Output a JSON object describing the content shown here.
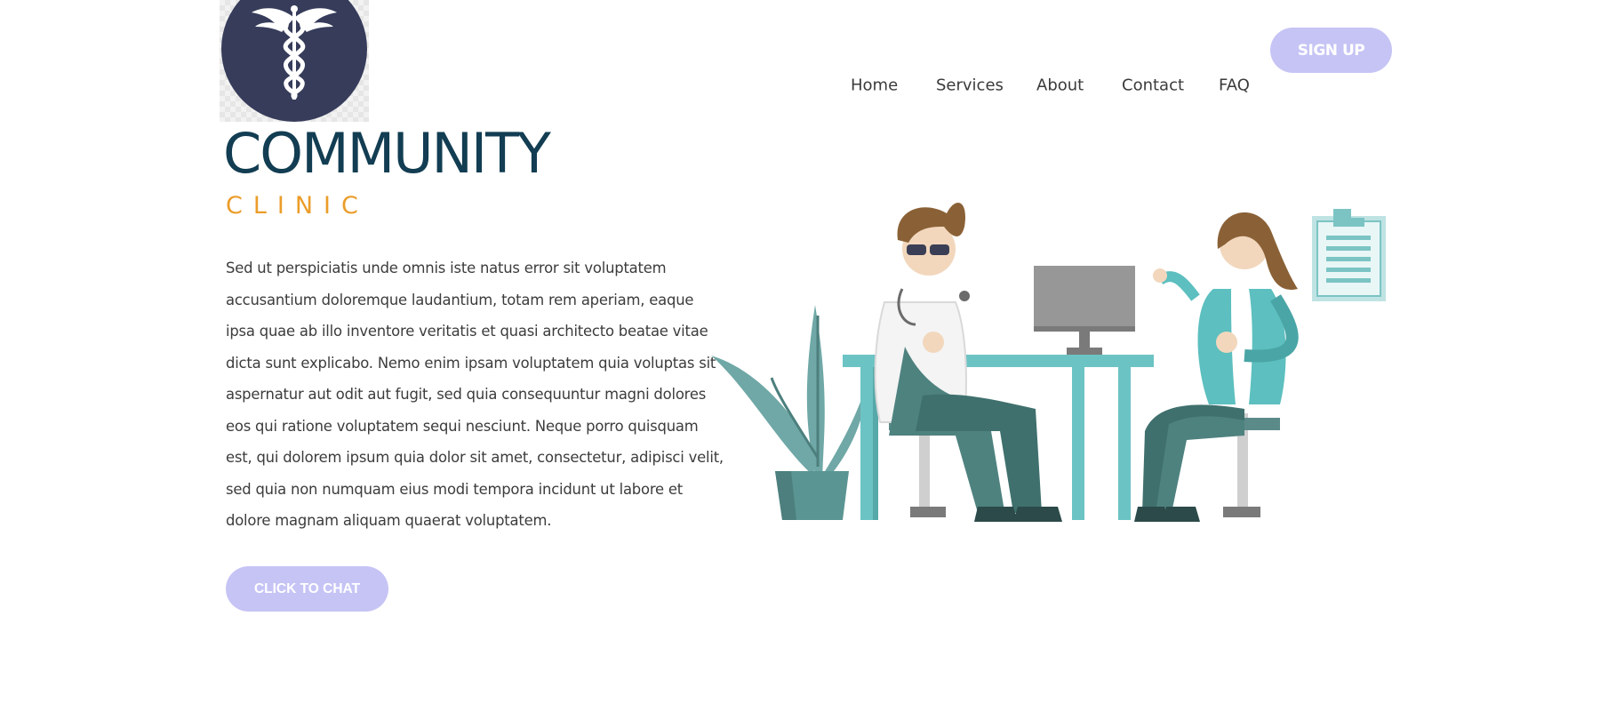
{
  "nav": {
    "items": [
      {
        "label": "Home"
      },
      {
        "label": "Services"
      },
      {
        "label": "About"
      },
      {
        "label": "Contact"
      },
      {
        "label": "FAQ"
      }
    ],
    "signup_label": "SIGN UP"
  },
  "hero": {
    "title": "COMMUNITY",
    "subtitle": "CLINIC",
    "body": "Sed ut perspiciatis unde omnis iste natus error sit voluptatem accusantium doloremque laudantium, totam rem aperiam, eaque ipsa quae ab illo inventore veritatis et quasi architecto beatae vitae dicta sunt explicabo. Nemo enim ipsam voluptatem quia voluptas sit aspernatur aut odit aut fugit, sed quia consequuntur magni dolores eos qui ratione voluptatem sequi nesciunt. Neque porro quisquam est, qui dolorem ipsum quia dolor sit amet, consectetur, adipisci velit, sed quia non numquam eius modi tempora incidunt ut labore et dolore magnam aliquam quaerat voluptatem.",
    "cta_label": "CLICK TO CHAT"
  },
  "logo": {
    "icon": "caduceus-icon"
  },
  "illustration": {
    "icon": "doctor-patient-illustration"
  },
  "colors": {
    "accent_button": "#c6c4f5",
    "title": "#123d52",
    "subtitle": "#eb9d2a",
    "logo_bg": "#363c5a",
    "teal": "#5dbfbf"
  }
}
